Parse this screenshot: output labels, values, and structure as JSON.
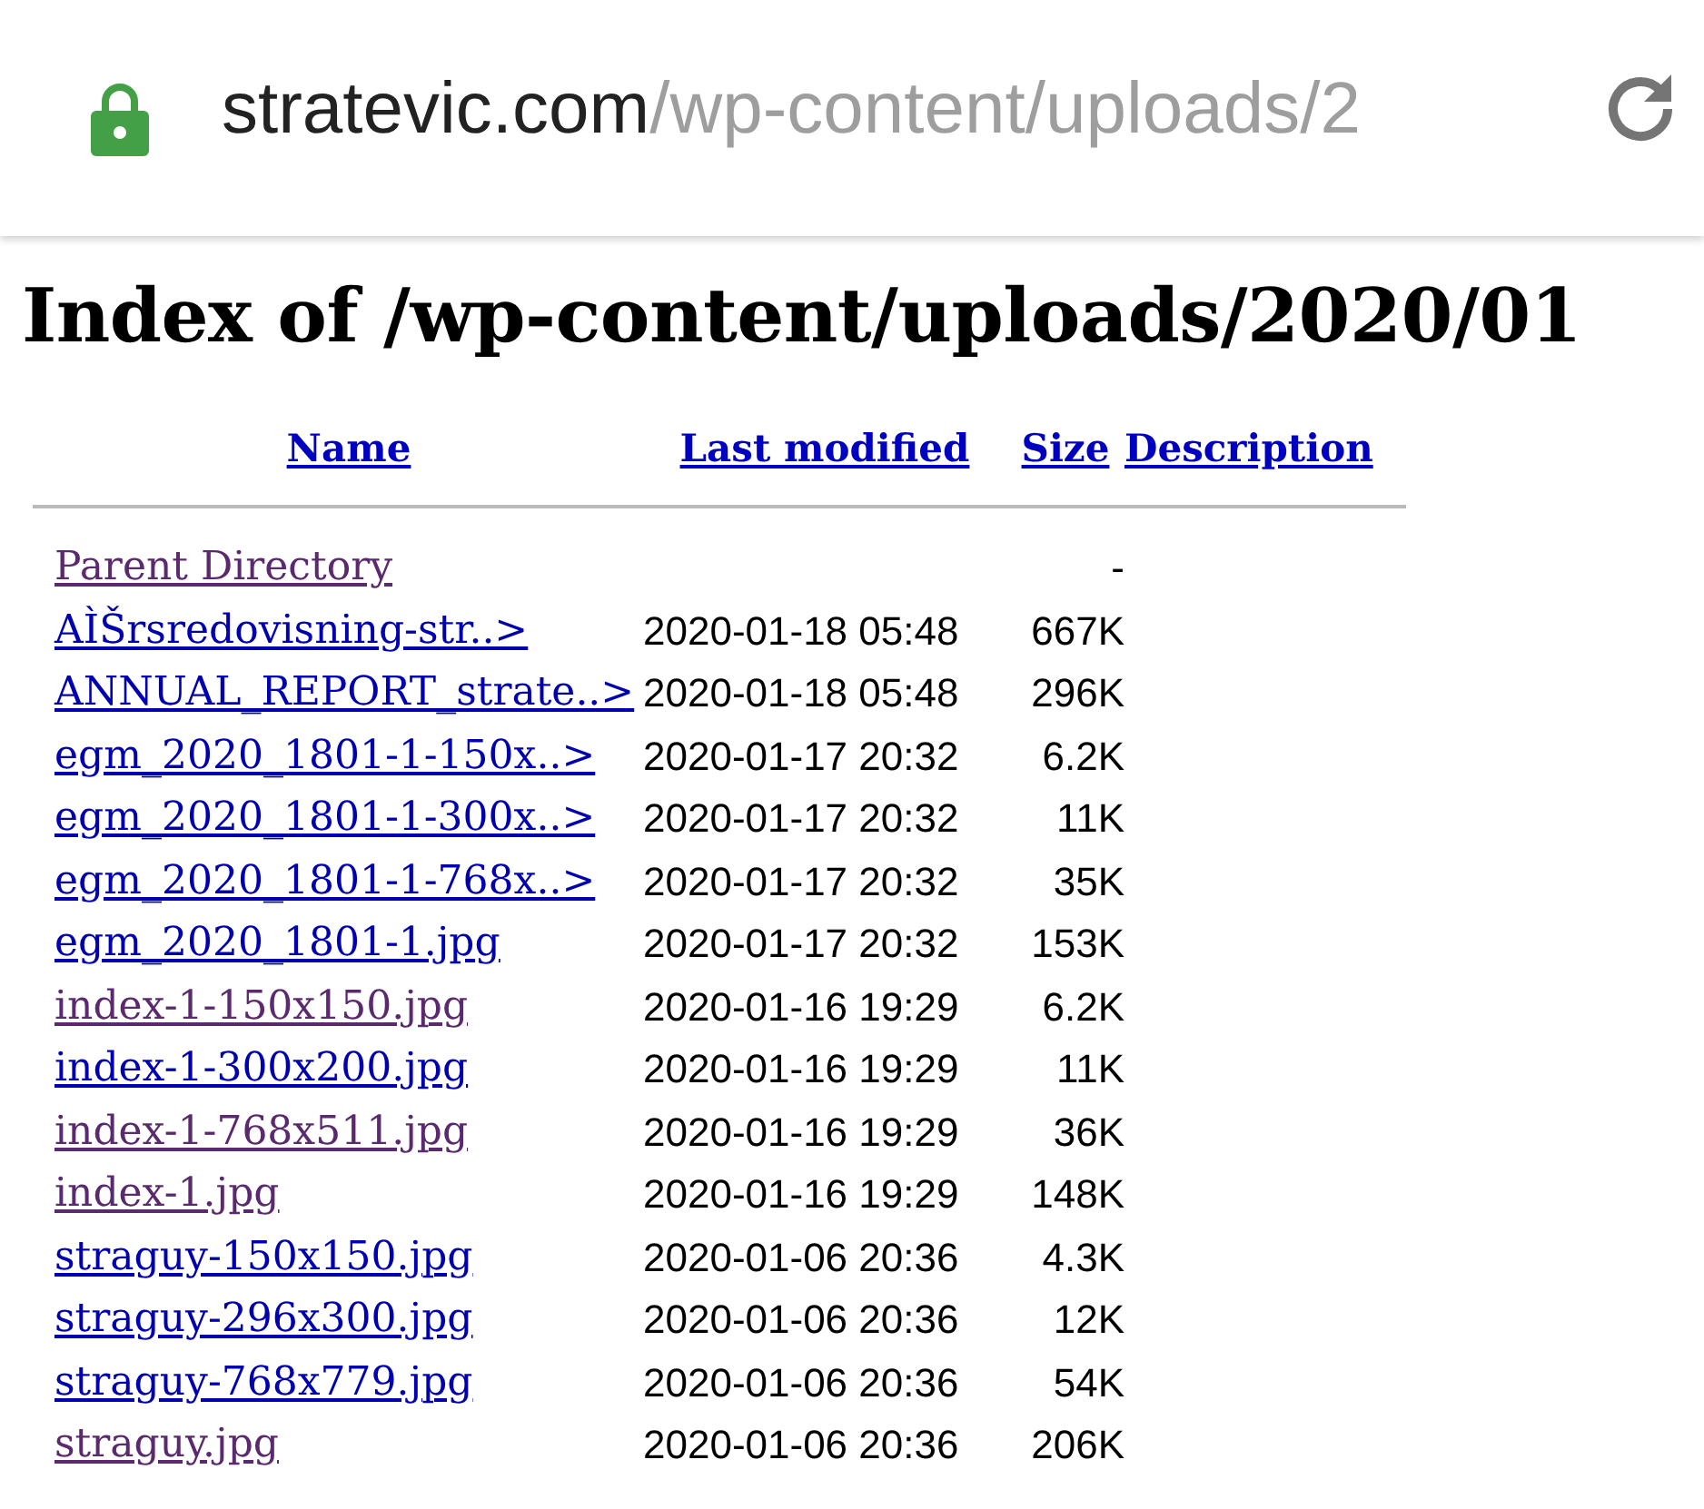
{
  "address_bar": {
    "host": "stratevic.com",
    "path": "/wp-content/uploads/2"
  },
  "heading": "Index of /wp-content/uploads/2020/01",
  "columns": [
    "Name",
    "Last modified",
    "Size",
    "Description"
  ],
  "rows": [
    {
      "name": "Parent Directory",
      "visited": true,
      "modified": "",
      "size": "-"
    },
    {
      "name": "AÌŠrsredovisning-str..>",
      "visited": false,
      "modified": "2020-01-18 05:48",
      "size": "667K"
    },
    {
      "name": "ANNUAL_REPORT_strate..>",
      "visited": false,
      "modified": "2020-01-18 05:48",
      "size": "296K"
    },
    {
      "name": "egm_2020_1801-1-150x..>",
      "visited": false,
      "modified": "2020-01-17 20:32",
      "size": "6.2K"
    },
    {
      "name": "egm_2020_1801-1-300x..>",
      "visited": false,
      "modified": "2020-01-17 20:32",
      "size": "11K"
    },
    {
      "name": "egm_2020_1801-1-768x..>",
      "visited": false,
      "modified": "2020-01-17 20:32",
      "size": "35K"
    },
    {
      "name": "egm_2020_1801-1.jpg",
      "visited": false,
      "modified": "2020-01-17 20:32",
      "size": "153K"
    },
    {
      "name": "index-1-150x150.jpg",
      "visited": true,
      "modified": "2020-01-16 19:29",
      "size": "6.2K"
    },
    {
      "name": "index-1-300x200.jpg",
      "visited": false,
      "modified": "2020-01-16 19:29",
      "size": "11K"
    },
    {
      "name": "index-1-768x511.jpg",
      "visited": true,
      "modified": "2020-01-16 19:29",
      "size": "36K"
    },
    {
      "name": "index-1.jpg",
      "visited": true,
      "modified": "2020-01-16 19:29",
      "size": "148K"
    },
    {
      "name": "straguy-150x150.jpg",
      "visited": false,
      "modified": "2020-01-06 20:36",
      "size": "4.3K"
    },
    {
      "name": "straguy-296x300.jpg",
      "visited": false,
      "modified": "2020-01-06 20:36",
      "size": "12K"
    },
    {
      "name": "straguy-768x779.jpg",
      "visited": false,
      "modified": "2020-01-06 20:36",
      "size": "54K"
    },
    {
      "name": "straguy.jpg",
      "visited": true,
      "modified": "2020-01-06 20:36",
      "size": "206K"
    }
  ]
}
